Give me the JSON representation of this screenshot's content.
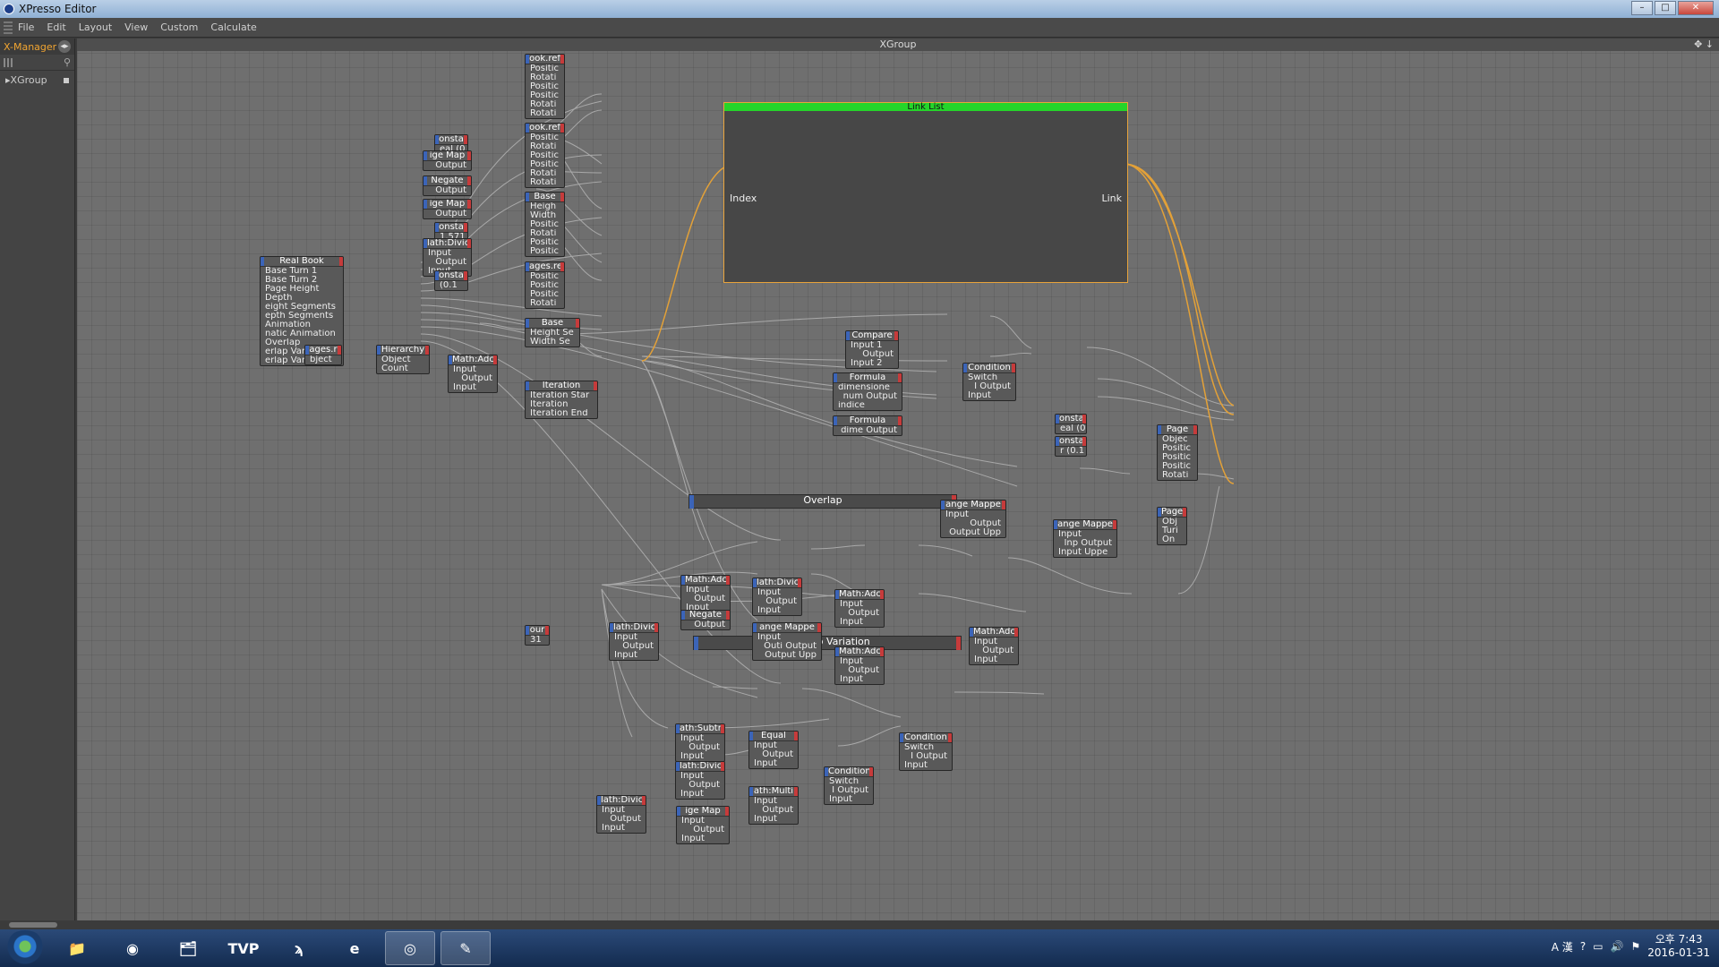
{
  "window": {
    "title": "XPresso Editor"
  },
  "menu": [
    "File",
    "Edit",
    "Layout",
    "View",
    "Custom",
    "Calculate"
  ],
  "sidebar": {
    "header": "X-Manager",
    "tree_item": "XGroup"
  },
  "editor": {
    "title": "XGroup"
  },
  "linklist": {
    "title": "Link List",
    "in_port": "Index",
    "out_port": "Link"
  },
  "groups": [
    {
      "label": "Overlap"
    },
    {
      "label": "Overlap Variation"
    }
  ],
  "nodes": [
    {
      "title": "ook.ref",
      "ports": [
        "Positic",
        "Rotati",
        "Positic",
        "Positic",
        "Rotati",
        "Rotati"
      ]
    },
    {
      "title": "ook.ref",
      "ports": [
        "Positic",
        "Rotati",
        "Positic",
        "Positic",
        "Rotati",
        "Rotati"
      ]
    },
    {
      "title": "Base",
      "ports": [
        "Heigh",
        "Width",
        "Positic",
        "Rotati",
        "Positic",
        "Positic"
      ]
    },
    {
      "title": "ages.re",
      "ports": [
        "Positic",
        "Positic",
        "Positic",
        "Rotati"
      ]
    },
    {
      "title": "Base",
      "ports": [
        "Height Se",
        "Width Se"
      ]
    },
    {
      "title": "onsta",
      "ports": [
        "eal (0"
      ]
    },
    {
      "title": "ige Map",
      "ports": [
        "Output"
      ]
    },
    {
      "title": "Negate",
      "ports": [
        "Output"
      ]
    },
    {
      "title": "ige Map",
      "ports": [
        "Output"
      ]
    },
    {
      "title": "onsta",
      "ports": [
        "1.571"
      ]
    },
    {
      "title": "lath:Divic",
      "ports": [
        "Input",
        "Output",
        "Input"
      ]
    },
    {
      "title": "onsta",
      "ports": [
        "(0.1"
      ]
    },
    {
      "title": "Real Book",
      "ports": [
        "Base Turn 1",
        "Base Turn 2",
        "Page Height",
        "Depth",
        "eight Segments",
        "epth Segments",
        "Animation",
        "natic Animation",
        "Overlap",
        "erlap Variation",
        "erlap Variation"
      ]
    },
    {
      "title": "ages.r",
      "ports": [
        "bject"
      ]
    },
    {
      "title": "Hierarchy",
      "ports": [
        "Object",
        "Count"
      ]
    },
    {
      "title": "Math:Adc",
      "ports": [
        "Input",
        "Output",
        "Input"
      ]
    },
    {
      "title": "Iteration",
      "ports": [
        "Iteration Star",
        "Iteration",
        "Iteration End"
      ]
    },
    {
      "title": "Compare",
      "ports": [
        "Input 1",
        "Output",
        "Input 2"
      ]
    },
    {
      "title": "Formula",
      "ports": [
        "dimensione",
        "num Output",
        "indice"
      ]
    },
    {
      "title": "Formula",
      "ports": [
        "dime Output"
      ]
    },
    {
      "title": "Condition",
      "ports": [
        "Switch",
        "I Output",
        "Input"
      ]
    },
    {
      "title": "onsta",
      "ports": [
        "eal (0"
      ]
    },
    {
      "title": "onsta",
      "ports": [
        "r (0.1"
      ]
    },
    {
      "title": "Page",
      "ports": [
        "Objec",
        "Positic",
        "Positic",
        "Positic",
        "Rotati"
      ]
    },
    {
      "title": "ange Mappe",
      "ports": [
        "Input",
        "Output",
        "Output Upp"
      ]
    },
    {
      "title": "ange Mappe",
      "ports": [
        "Input",
        "Inp Output",
        "Input Uppe"
      ]
    },
    {
      "title": "Page",
      "ports": [
        "Obj",
        "Turi",
        "On"
      ]
    },
    {
      "title": "Math:Adc",
      "ports": [
        "Input",
        "Output",
        "Input"
      ]
    },
    {
      "title": "lath:Divic",
      "ports": [
        "Input",
        "Output",
        "Input"
      ]
    },
    {
      "title": "Math:Adc",
      "ports": [
        "Input",
        "Output",
        "Input"
      ]
    },
    {
      "title": "Negate",
      "ports": [
        "Output"
      ]
    },
    {
      "title": "our",
      "ports": [
        "31"
      ]
    },
    {
      "title": "lath:Divic",
      "ports": [
        "Input",
        "Output",
        "Input"
      ]
    },
    {
      "title": "ange Mappe",
      "ports": [
        "Input",
        "Outi Output",
        "Output Upp"
      ]
    },
    {
      "title": "Math:Adc",
      "ports": [
        "Input",
        "Output",
        "Input"
      ]
    },
    {
      "title": "Math:Adc",
      "ports": [
        "Input",
        "Output",
        "Input"
      ]
    },
    {
      "title": "ath:Subtr",
      "ports": [
        "Input",
        "Output",
        "Input"
      ]
    },
    {
      "title": "Equal",
      "ports": [
        "Input",
        "Output",
        "Input"
      ]
    },
    {
      "title": "Condition",
      "ports": [
        "Switch",
        "I Output",
        "Input"
      ]
    },
    {
      "title": "lath:Divic",
      "ports": [
        "Input",
        "Output",
        "Input"
      ]
    },
    {
      "title": "Condition",
      "ports": [
        "Switch",
        "I Output",
        "Input"
      ]
    },
    {
      "title": "ath:Multi",
      "ports": [
        "Input",
        "Output",
        "Input"
      ]
    },
    {
      "title": "lath:Divic",
      "ports": [
        "Input",
        "Output",
        "Input"
      ]
    },
    {
      "title": "ige Map",
      "ports": [
        "Input",
        "Output",
        "Input"
      ]
    }
  ],
  "taskbar": {
    "tvp_label": "TVP",
    "clock_time": "오후 7:43",
    "clock_date": "2016-01-31",
    "tray_text": "A 漢"
  }
}
